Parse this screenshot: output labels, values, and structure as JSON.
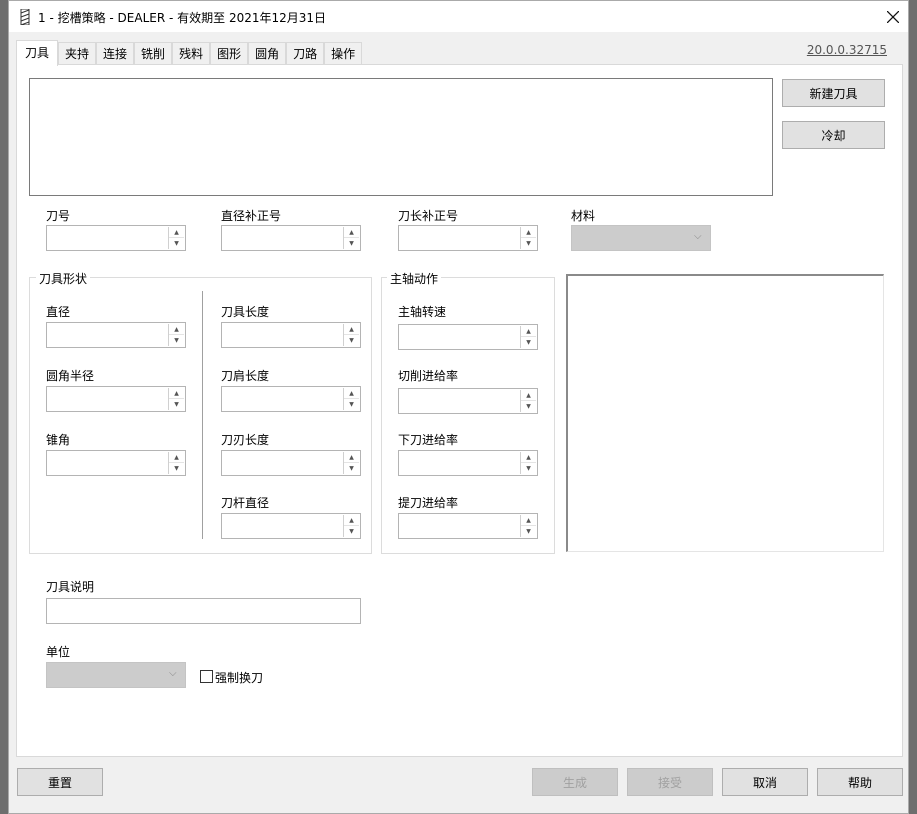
{
  "window": {
    "title": "1 - 挖槽策略 - DEALER - 有效期至 2021年12月31日",
    "version": "20.0.0.32715"
  },
  "tabs": [
    "刀具",
    "夹持",
    "连接",
    "铣削",
    "残料",
    "图形",
    "圆角",
    "刀路",
    "操作"
  ],
  "side_buttons": {
    "new_tool": "新建刀具",
    "coolant": "冷却"
  },
  "top_fields": {
    "tool_number": "刀号",
    "diameter_offset": "直径补正号",
    "length_offset": "刀长补正号",
    "material": "材料"
  },
  "tool_shape": {
    "title": "刀具形状",
    "diameter": "直径",
    "corner_radius": "圆角半径",
    "taper_angle": "锥角",
    "tool_length": "刀具长度",
    "shoulder_length": "刀肩长度",
    "flute_length": "刀刃长度",
    "shank_diameter": "刀杆直径"
  },
  "spindle": {
    "title": "主轴动作",
    "speed": "主轴转速",
    "cut_feed": "切削进给率",
    "plunge_feed": "下刀进给率",
    "retract_feed": "提刀进给率"
  },
  "tool_description": "刀具说明",
  "unit": "单位",
  "force_change": "强制换刀",
  "footer": {
    "reset": "重置",
    "generate": "生成",
    "accept": "接受",
    "cancel": "取消",
    "help": "帮助"
  }
}
